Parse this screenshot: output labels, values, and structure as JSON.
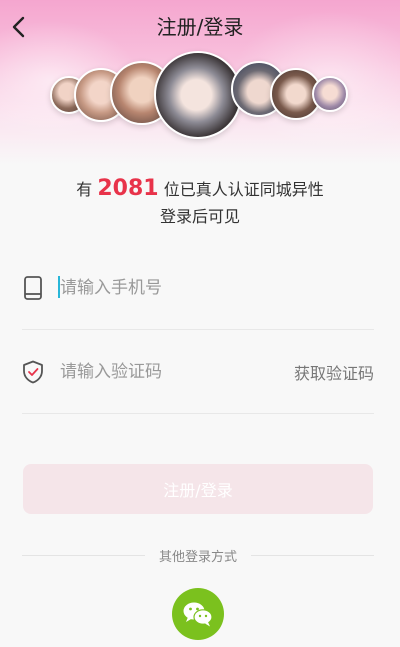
{
  "header": {
    "title": "注册/登录",
    "back_icon": "chevron-left-icon"
  },
  "counter": {
    "prefix": "有",
    "count": "2081",
    "suffix": "位已真人认证同城异性",
    "subtitle": "登录后可见"
  },
  "form": {
    "phone_placeholder": "请输入手机号",
    "code_placeholder": "请输入验证码",
    "get_code_label": "获取验证码",
    "submit_label": "注册/登录"
  },
  "other_login": {
    "label": "其他登录方式",
    "wechat_icon": "wechat-icon"
  },
  "colors": {
    "accent_number": "#e8334a",
    "submit_bg": "#f5e5e9",
    "wechat_green": "#7bc11e",
    "caret": "#28b6d8"
  }
}
